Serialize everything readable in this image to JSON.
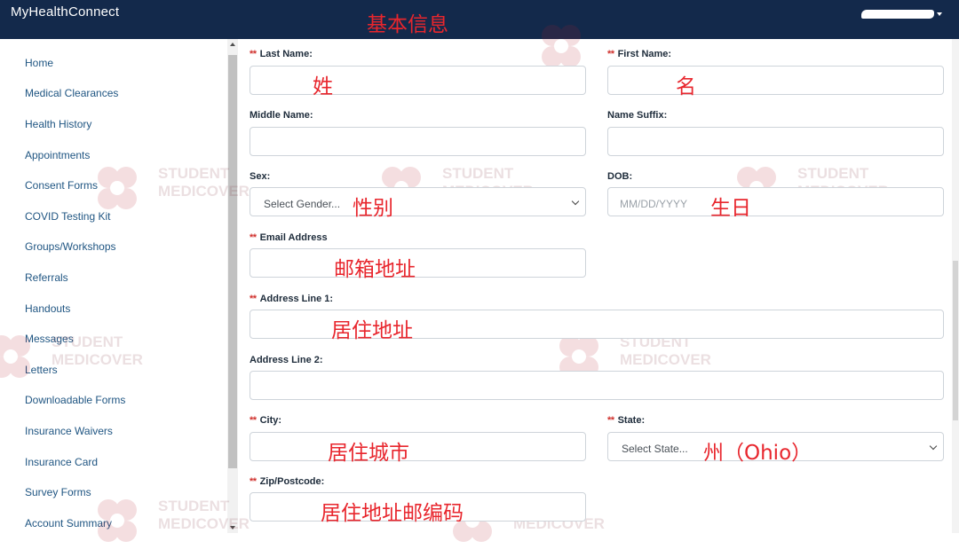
{
  "app": {
    "title": "MyHealthConnect"
  },
  "annotations": {
    "page_title": "基本信息",
    "last_name": "姓",
    "first_name": "名",
    "sex": "性别",
    "dob": "生日",
    "email": "邮箱地址",
    "address_line_1": "居住地址",
    "city": "居住城市",
    "state": "州（Ohio）",
    "zip": "居住地址邮编码"
  },
  "sidebar": {
    "items": [
      {
        "label": "Home"
      },
      {
        "label": "Medical Clearances"
      },
      {
        "label": "Health History"
      },
      {
        "label": "Appointments"
      },
      {
        "label": "Consent Forms"
      },
      {
        "label": "COVID Testing Kit"
      },
      {
        "label": "Groups/Workshops"
      },
      {
        "label": "Referrals"
      },
      {
        "label": "Handouts"
      },
      {
        "label": "Messages"
      },
      {
        "label": "Letters"
      },
      {
        "label": "Downloadable Forms"
      },
      {
        "label": "Insurance Waivers"
      },
      {
        "label": "Insurance Card"
      },
      {
        "label": "Survey Forms"
      },
      {
        "label": "Account Summary"
      }
    ]
  },
  "form": {
    "required_marker": "**",
    "last_name": {
      "label": "Last Name:",
      "value": ""
    },
    "first_name": {
      "label": "First Name:",
      "value": ""
    },
    "middle_name": {
      "label": "Middle Name:",
      "value": ""
    },
    "name_suffix": {
      "label": "Name Suffix:",
      "value": ""
    },
    "sex": {
      "label": "Sex:",
      "selected": "Select Gender..."
    },
    "dob": {
      "label": "DOB:",
      "placeholder": "MM/DD/YYYY"
    },
    "email": {
      "label": "Email Address",
      "value": ""
    },
    "address_line_1": {
      "label": "Address Line 1:",
      "value": ""
    },
    "address_line_2": {
      "label": "Address Line 2:",
      "value": ""
    },
    "city": {
      "label": "City:",
      "value": ""
    },
    "state": {
      "label": "State:",
      "selected": "Select State..."
    },
    "zip": {
      "label": "Zip/Postcode:",
      "value": ""
    }
  },
  "watermark": {
    "line1": "STUDENT",
    "line2": "MEDICOVER"
  },
  "colors": {
    "topbar": "#13294b",
    "nav_link": "#1f5582",
    "required": "#d0312d",
    "annotation": "#e8262d"
  }
}
